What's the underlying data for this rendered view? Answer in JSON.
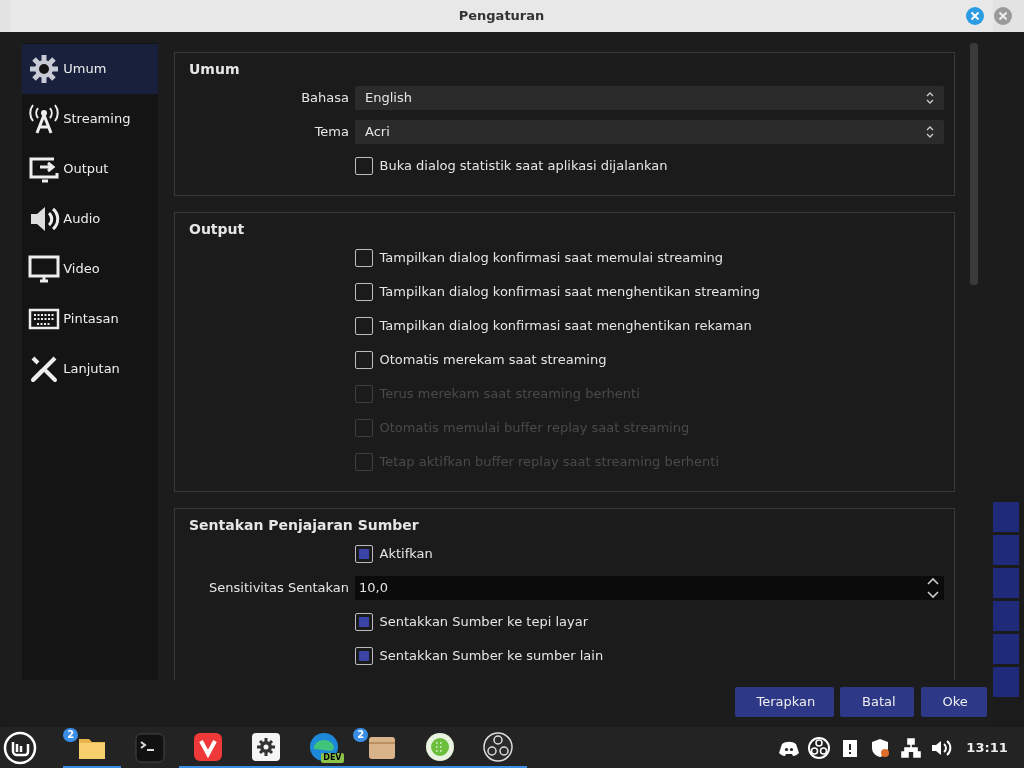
{
  "dialog": {
    "title": "Pengaturan"
  },
  "sidebar": {
    "items": [
      {
        "label": "Umum",
        "selected": true
      },
      {
        "label": "Streaming",
        "selected": false
      },
      {
        "label": "Output",
        "selected": false
      },
      {
        "label": "Audio",
        "selected": false
      },
      {
        "label": "Video",
        "selected": false
      },
      {
        "label": "Pintasan",
        "selected": false
      },
      {
        "label": "Lanjutan",
        "selected": false
      }
    ]
  },
  "groups": [
    {
      "title": "Umum",
      "rows": [
        {
          "kind": "select",
          "label": "Bahasa",
          "value": "English"
        },
        {
          "kind": "select",
          "label": "Tema",
          "value": "Acri"
        },
        {
          "kind": "checkbox",
          "label": "Buka dialog statistik saat aplikasi dijalankan",
          "checked": false,
          "disabled": false
        }
      ]
    },
    {
      "title": "Output",
      "rows": [
        {
          "kind": "checkbox",
          "label": "Tampilkan dialog konfirmasi saat memulai streaming",
          "checked": false,
          "disabled": false
        },
        {
          "kind": "checkbox",
          "label": "Tampilkan dialog konfirmasi saat menghentikan streaming",
          "checked": false,
          "disabled": false
        },
        {
          "kind": "checkbox",
          "label": "Tampilkan dialog konfirmasi saat menghentikan rekaman",
          "checked": false,
          "disabled": false
        },
        {
          "kind": "checkbox",
          "label": "Otomatis merekam saat streaming",
          "checked": false,
          "disabled": false
        },
        {
          "kind": "checkbox",
          "label": "Terus merekam saat streaming berhenti",
          "checked": false,
          "disabled": true
        },
        {
          "kind": "checkbox",
          "label": "Otomatis memulai buffer replay saat streaming",
          "checked": false,
          "disabled": true
        },
        {
          "kind": "checkbox",
          "label": "Tetap aktifkan buffer replay saat streaming berhenti",
          "checked": false,
          "disabled": true
        }
      ]
    },
    {
      "title": "Sentakan Penjajaran Sumber",
      "rows": [
        {
          "kind": "checkbox",
          "label": "Aktifkan",
          "checked": true,
          "disabled": false
        },
        {
          "kind": "spin",
          "label": "Sensitivitas Sentakan",
          "value": "10,0"
        },
        {
          "kind": "checkbox",
          "label": "Sentakkan Sumber ke tepi layar",
          "checked": true,
          "disabled": false
        },
        {
          "kind": "checkbox",
          "label": "Sentakkan Sumber ke sumber lain",
          "checked": true,
          "disabled": false
        }
      ]
    }
  ],
  "buttons": [
    {
      "label": "Terapkan"
    },
    {
      "label": "Batal"
    },
    {
      "label": "Oke"
    }
  ],
  "taskbar": {
    "apps": [
      {
        "badge": "2",
        "running": true
      },
      {
        "running": false
      },
      {
        "running": true
      },
      {
        "running": true
      },
      {
        "badge": "DEV",
        "running": true
      },
      {
        "badge": "2",
        "running": true
      },
      {
        "running": true
      },
      {
        "running": true
      }
    ],
    "clock": "13:11"
  }
}
